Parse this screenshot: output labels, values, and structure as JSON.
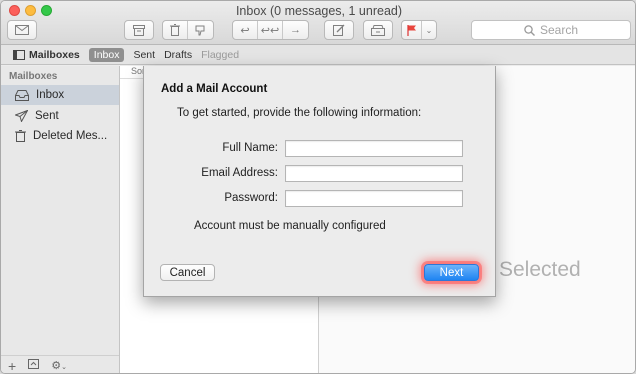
{
  "window": {
    "title": "Inbox (0 messages, 1 unread)"
  },
  "toolbar": {
    "get_mail_icon": "envelope-icon",
    "search_placeholder": "Search"
  },
  "favorites": {
    "mailboxes": "Mailboxes",
    "inbox": "Inbox",
    "sent": "Sent",
    "drafts": "Drafts",
    "flagged": "Flagged"
  },
  "sidebar": {
    "heading": "Mailboxes",
    "items": [
      {
        "label": "Inbox",
        "icon": "inbox-tray-icon"
      },
      {
        "label": "Sent",
        "icon": "paper-plane-icon"
      },
      {
        "label": "Deleted Mes...",
        "icon": "trash-icon"
      }
    ]
  },
  "message_list": {
    "sort_label": "Sor"
  },
  "viewer": {
    "empty_text": "Selected"
  },
  "dialog": {
    "title": "Add a Mail Account",
    "subtitle": "To get started, provide the following information:",
    "full_name_label": "Full Name:",
    "email_label": "Email Address:",
    "password_label": "Password:",
    "full_name_value": "",
    "email_value": "",
    "password_value": "",
    "note": "Account must be manually configured",
    "cancel_label": "Cancel",
    "next_label": "Next"
  },
  "colors": {
    "accent_blue": "#1f84f2",
    "highlight_red": "#ff4646",
    "close": "#fc605b",
    "minimize": "#fdbc40",
    "maximize": "#34c84a"
  }
}
